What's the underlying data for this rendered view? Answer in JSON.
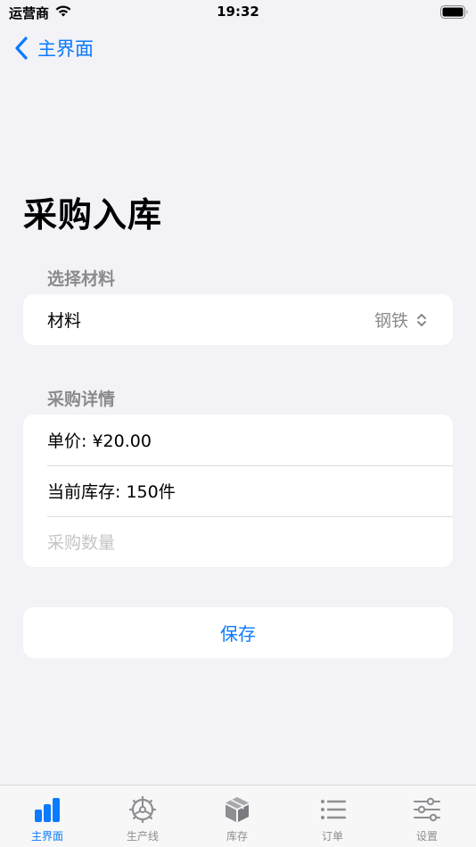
{
  "status_bar": {
    "carrier": "运营商",
    "time": "19:32"
  },
  "nav": {
    "back_label": "主界面"
  },
  "page": {
    "title": "采购入库"
  },
  "material_section": {
    "header": "选择材料",
    "material_label": "材料",
    "material_value": "钢铁"
  },
  "details_section": {
    "header": "采购详情",
    "unit_price": "单价: ¥20.00",
    "current_stock": "当前库存: 150件",
    "quantity_placeholder": "采购数量"
  },
  "save_label": "保存",
  "tabs": [
    {
      "label": "主界面",
      "icon": "chart-bar-icon",
      "active": true
    },
    {
      "label": "生产线",
      "icon": "steering-wheel-icon",
      "active": false
    },
    {
      "label": "库存",
      "icon": "box-icon",
      "active": false
    },
    {
      "label": "订单",
      "icon": "list-icon",
      "active": false
    },
    {
      "label": "设置",
      "icon": "sliders-icon",
      "active": false
    }
  ],
  "colors": {
    "accent": "#0a7aff",
    "background": "#f2f2f7",
    "inactive": "#8e8e93"
  }
}
